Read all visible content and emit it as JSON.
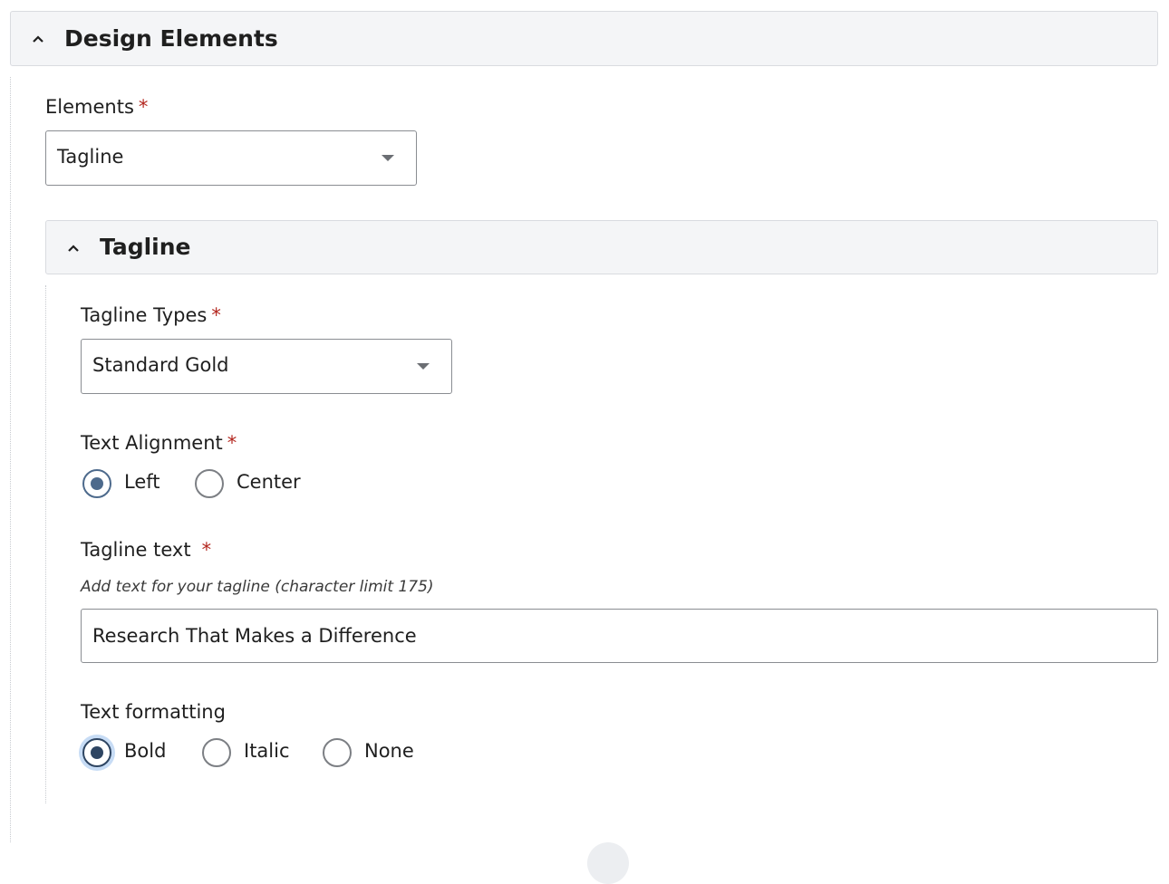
{
  "design_elements": {
    "title": "Design Elements",
    "elements_field": {
      "label": "Elements",
      "required_marker": "*",
      "selected": "Tagline"
    }
  },
  "tagline_section": {
    "title": "Tagline",
    "types_field": {
      "label": "Tagline Types",
      "required_marker": "*",
      "selected": "Standard Gold"
    },
    "alignment_field": {
      "label": "Text Alignment",
      "required_marker": "*",
      "options": [
        "Left",
        "Center"
      ],
      "selected": "Left"
    },
    "text_field": {
      "label": "Tagline text",
      "required_marker": "*",
      "help": "Add text for your tagline (character limit 175)",
      "value": "Research That Makes a Difference"
    },
    "formatting_field": {
      "label": "Text formatting",
      "options": [
        "Bold",
        "Italic",
        "None"
      ],
      "selected": "Bold"
    }
  },
  "colors": {
    "accent": "#4d6a8c",
    "required": "#b3261e",
    "header_bg": "#f4f5f7",
    "focus_ring": "#c7dcf5"
  },
  "icons": {
    "collapse": "chevron-up-icon",
    "dropdown": "caret-down-icon"
  }
}
